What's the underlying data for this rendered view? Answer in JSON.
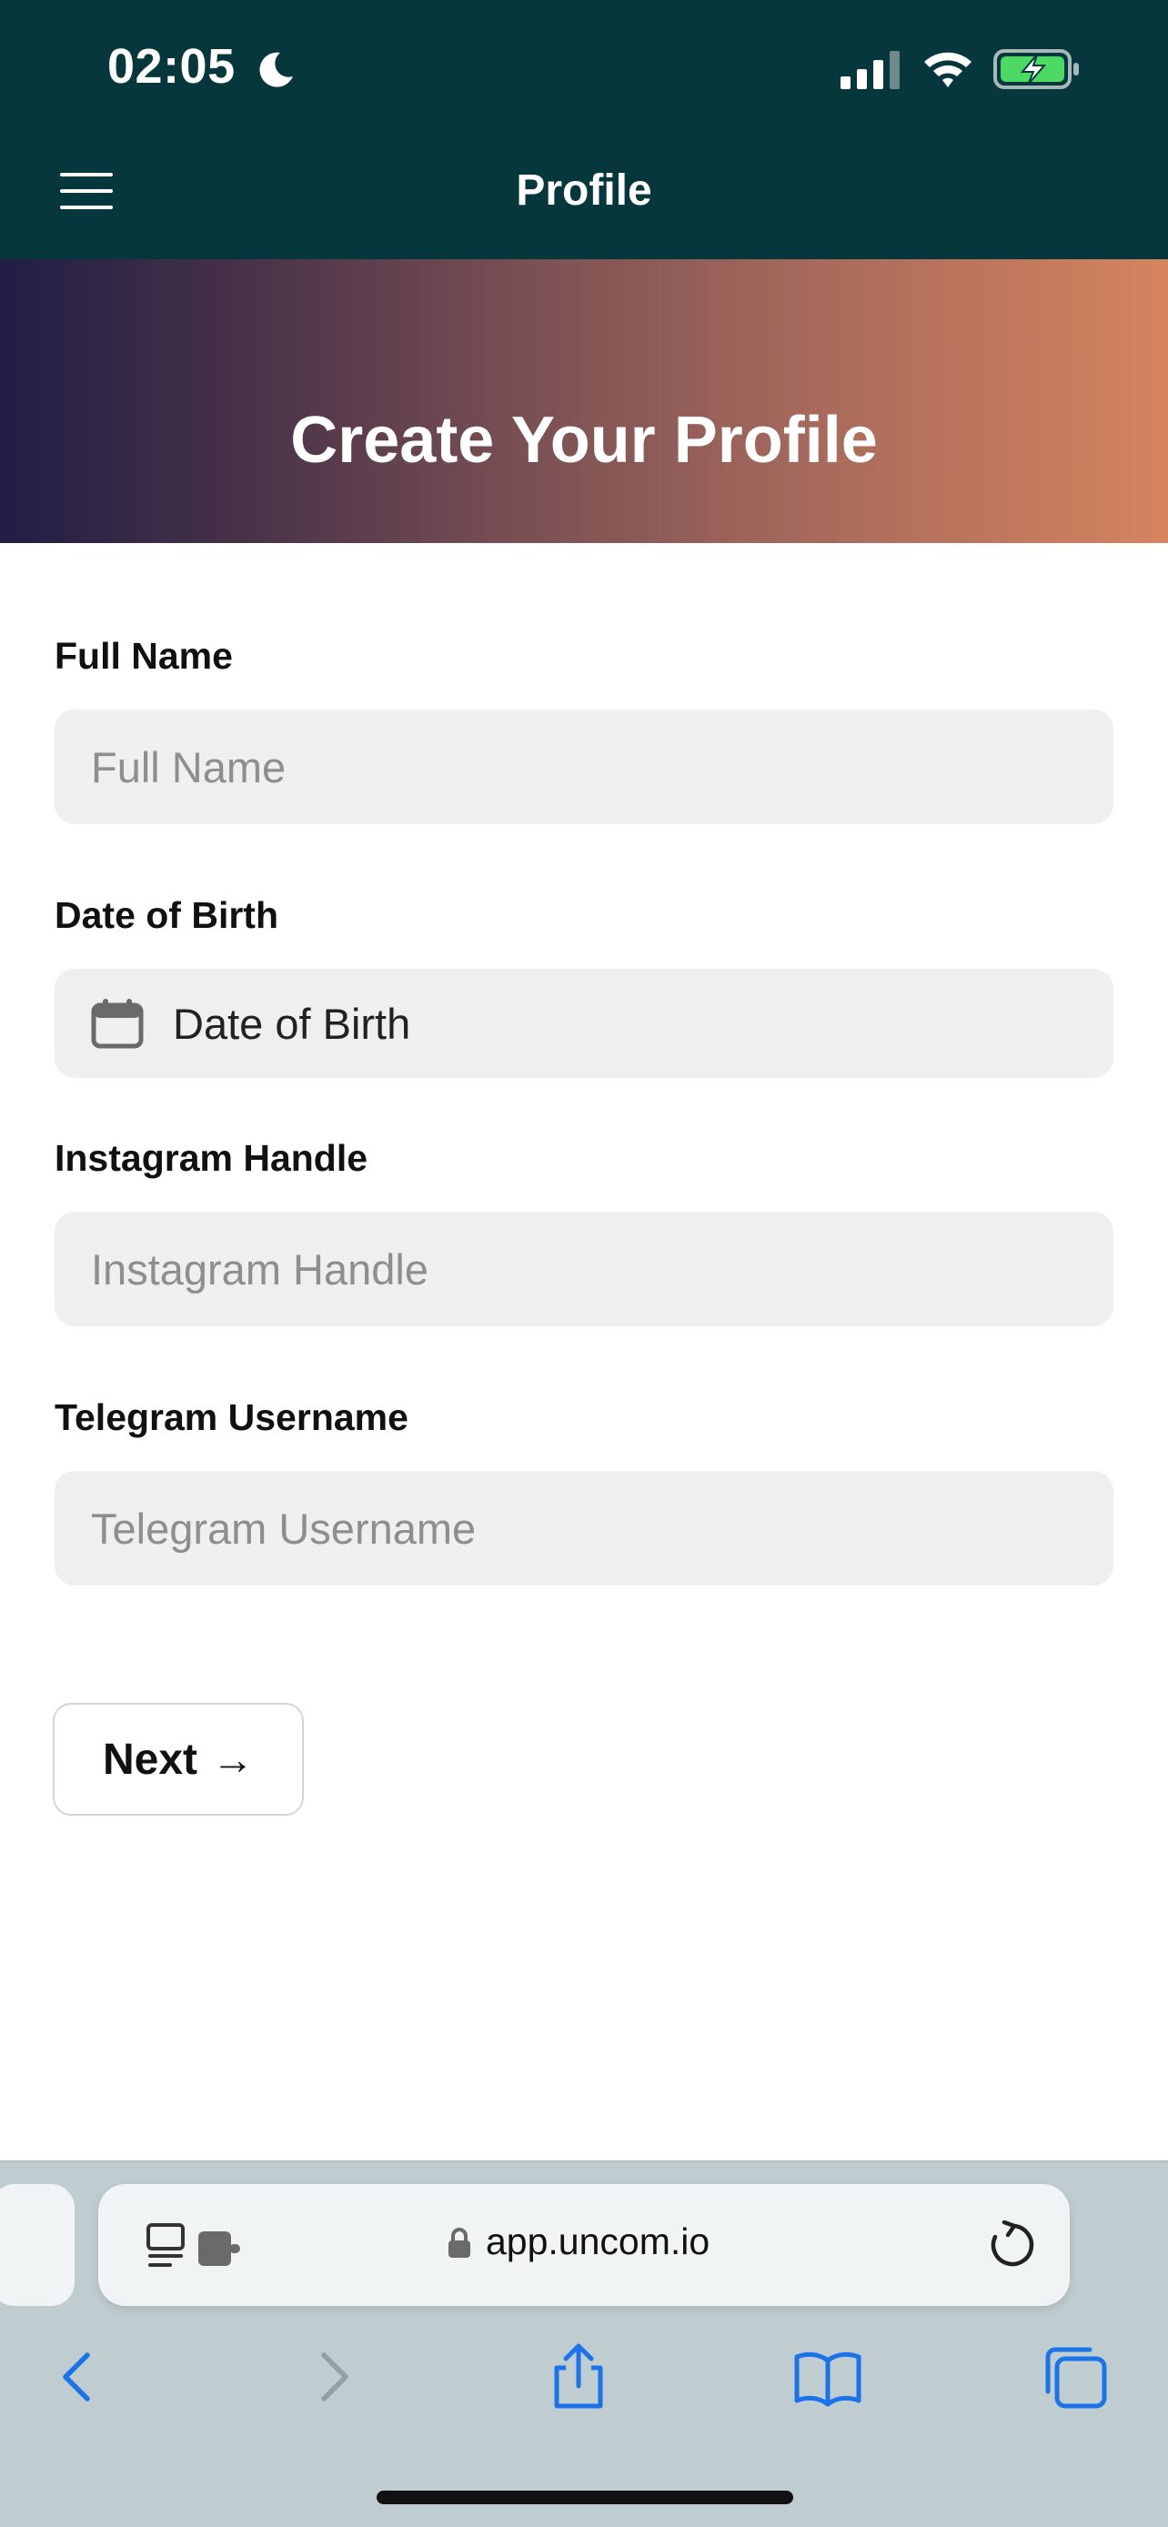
{
  "status_bar": {
    "time": "02:05"
  },
  "header": {
    "title": "Profile"
  },
  "banner": {
    "title": "Create Your Profile"
  },
  "form": {
    "full_name": {
      "label": "Full Name",
      "placeholder": "Full Name"
    },
    "dob": {
      "label": "Date of Birth",
      "value": "Date of Birth"
    },
    "instagram": {
      "label": "Instagram Handle",
      "placeholder": "Instagram Handle"
    },
    "telegram": {
      "label": "Telegram Username",
      "placeholder": "Telegram Username"
    },
    "next_label": "Next",
    "next_arrow": "→"
  },
  "browser": {
    "url": "app.uncom.io"
  },
  "colors": {
    "header_bg": "#05373d",
    "banner_gradient_start": "#211e45",
    "banner_gradient_end": "#d5845e",
    "field_bg": "#efefef",
    "browser_bar_bg": "#bfcdd1",
    "link_blue": "#1a73e8"
  },
  "icons": [
    "moon-icon",
    "signal-icon",
    "wifi-icon",
    "battery-charging-icon",
    "menu-icon",
    "calendar-icon",
    "reader-icon",
    "lock-icon",
    "reload-icon",
    "back-icon",
    "forward-icon",
    "share-icon",
    "bookmarks-icon",
    "tabs-icon"
  ]
}
